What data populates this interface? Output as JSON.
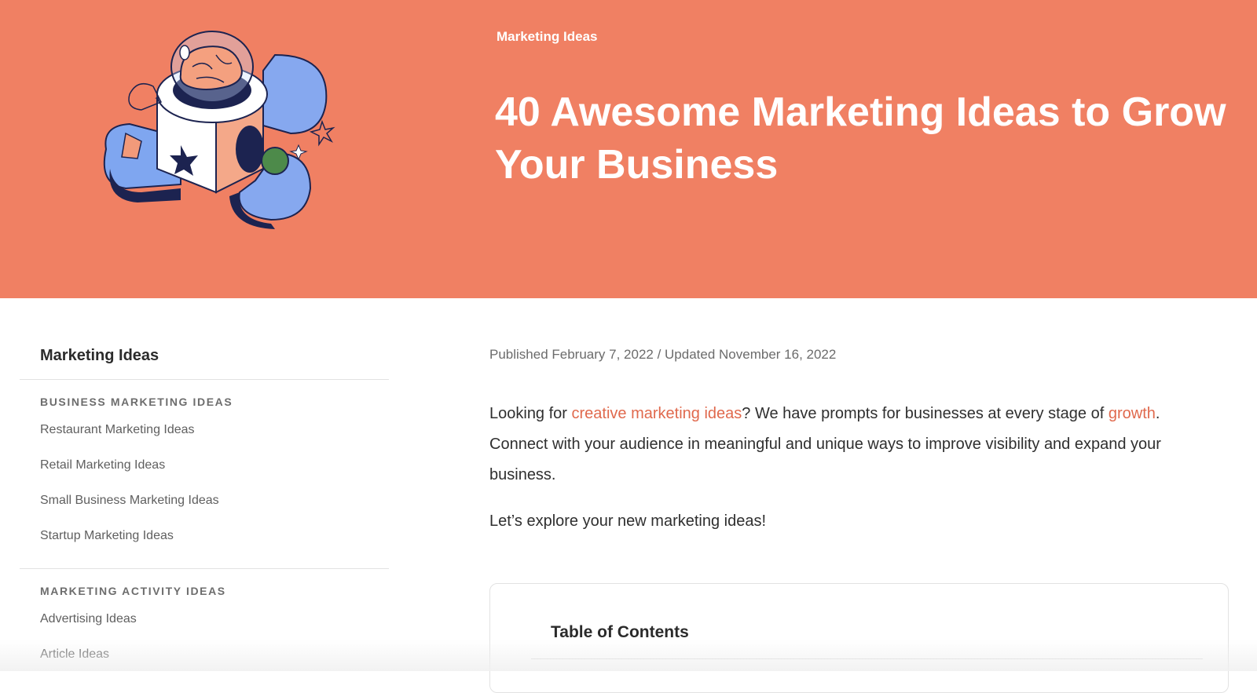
{
  "hero": {
    "breadcrumb": "Marketing Ideas",
    "title": "40 Awesome Marketing Ideas to Grow Your Business",
    "background_color": "#f08063",
    "illustration_icon": "brain-cube-illustration"
  },
  "sidebar": {
    "title": "Marketing Ideas",
    "sections": [
      {
        "heading": "BUSINESS MARKETING IDEAS",
        "links": [
          "Restaurant Marketing Ideas",
          "Retail Marketing Ideas",
          "Small Business Marketing Ideas",
          "Startup Marketing Ideas"
        ]
      },
      {
        "heading": "MARKETING ACTIVITY IDEAS",
        "links": [
          "Advertising Ideas",
          "Article Ideas"
        ]
      }
    ]
  },
  "main": {
    "meta": "Published February 7, 2022 / Updated November 16, 2022",
    "intro": {
      "part1": "Looking for ",
      "link1": "creative marketing ideas",
      "part2": "? We have prompts for businesses at every stage of ",
      "link2": "growth",
      "part3": ". Connect with your audience in meaningful and unique ways to improve visibility and expand your business."
    },
    "intro2": "Let’s explore your new marketing ideas!",
    "link_color": "#e0694d"
  },
  "toc": {
    "title": "Table of Contents"
  }
}
